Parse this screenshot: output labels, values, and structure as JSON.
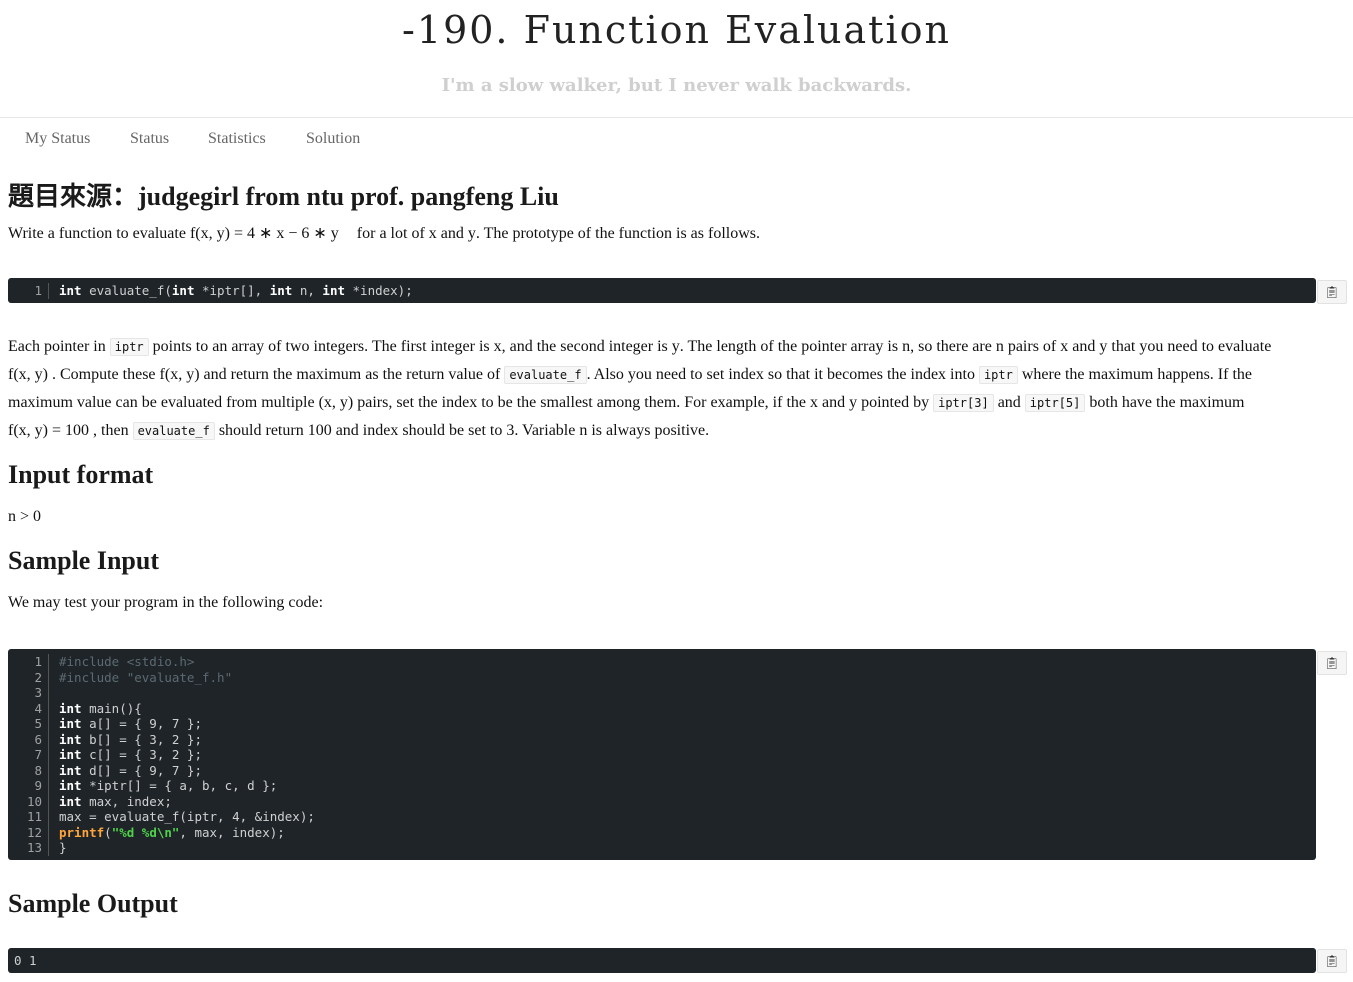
{
  "header": {
    "title": "-190. Function Evaluation",
    "subtitle": "I'm a slow walker, but I never walk backwards."
  },
  "nav": {
    "items": [
      "My Status",
      "Status",
      "Statistics",
      "Solution"
    ]
  },
  "problem": {
    "source_heading": "題目來源：judgegirl from ntu prof. pangfeng Liu",
    "intro_text_a": "Write a function to evaluate ",
    "intro_formula": "f(x, y) = 4 ∗ x − 6 ∗ y",
    "intro_text_b": " for a lot of ",
    "intro_var_x": "x",
    "intro_text_c": " and ",
    "intro_var_y": "y",
    "intro_text_d": ". The prototype of the function is as follows.",
    "prototype_code": {
      "line_number": "1",
      "keyword_int": "int",
      "rest_a": " evaluate_f(",
      "rest_b": " *iptr[], ",
      "rest_c": " n, ",
      "rest_d": " *index);"
    },
    "desc": {
      "p1": "Each pointer in ",
      "c_iptr": "iptr",
      "p2": " points to an array of two integers. The first integer is ",
      "x": "x",
      "p3": ", and the second integer is ",
      "y": "y",
      "p4": ". The length of the pointer array is ",
      "n": "n",
      "p5": ", so there are ",
      "p6": " pairs of ",
      "p7": " and ",
      "p8": " that you need to evaluate",
      "f": "f(x, y)",
      "p9": " . Compute these ",
      "p10": "  and return the maximum as the return value of ",
      "c_eval": "evaluate_f",
      "p11": ". Also you need to set index so that it becomes the index into ",
      "p12": " where the maximum happens. If the",
      "p13": "maximum value can be evaluated from multiple ",
      "xy": "(x, y)",
      "p14": "  pairs, set the index to be the smallest among them. For example, if the ",
      "p15": " and ",
      "p16": " pointed by ",
      "c_iptr3": "iptr[3]",
      "p17": " and ",
      "c_iptr5": "iptr[5]",
      "p18": " both have the maximum",
      "f100": "f(x, y) = 100",
      "p19": "  , then ",
      "p20": " should return ",
      "v100": "100",
      "p21": " and index should be set to ",
      "v3": "3",
      "p22": ". Variable ",
      "p23": " is always positive."
    },
    "input_format_heading": "Input format",
    "input_format_text": "n > 0",
    "sample_input_heading": "Sample Input",
    "sample_input_text": "We may test your program in the following code:",
    "sample_code_lines": [
      "#include <stdio.h>",
      "#include \"evaluate_f.h\"",
      "",
      "int main(){",
      "int a[] = { 9, 7 };",
      "int b[] = { 3, 2 };",
      "int c[] = { 3, 2 };",
      "int d[] = { 9, 7 };",
      "int *iptr[] = { a, b, c, d };",
      "int max, index;",
      "max = evaluate_f(iptr, 4, &index);",
      "printf(\"%d %d\\n\", max, index);",
      "}"
    ],
    "sample_output_heading": "Sample Output",
    "sample_output": "0 1",
    "copy_icon": "clipboard-icon"
  }
}
